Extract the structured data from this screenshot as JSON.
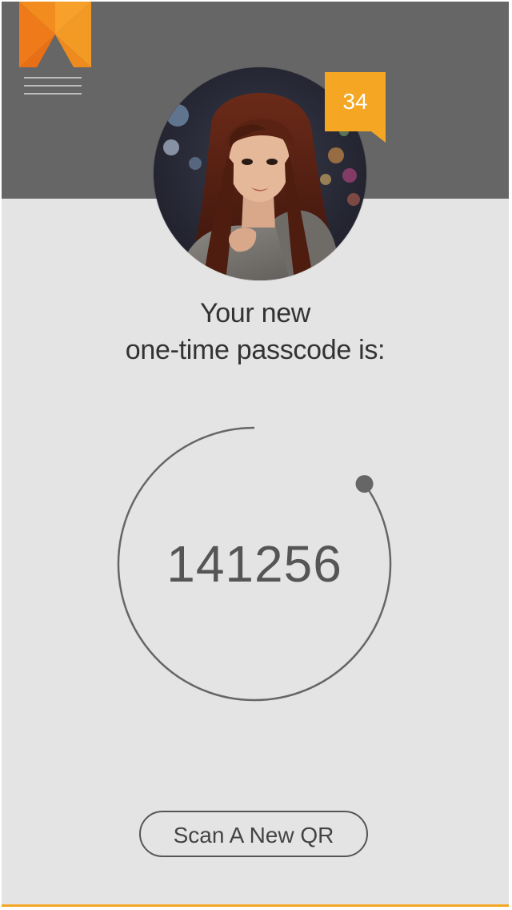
{
  "header": {
    "logo_icon": "bookmark-logo-icon",
    "menu_icon": "hamburger-menu-icon",
    "notification_count": "34"
  },
  "profile": {
    "avatar": "user-avatar-photo"
  },
  "main": {
    "headline_line1": "Your new",
    "headline_line2": "one-time passcode is:",
    "passcode": "141256",
    "timer_remaining_fraction": 0.85,
    "scan_button_label": "Scan A New QR"
  },
  "colors": {
    "header_background": "#666666",
    "page_background": "#e4e4e4",
    "accent": "#f5a623",
    "accent_dark": "#e57f1c",
    "timer_ring": "#666666"
  }
}
